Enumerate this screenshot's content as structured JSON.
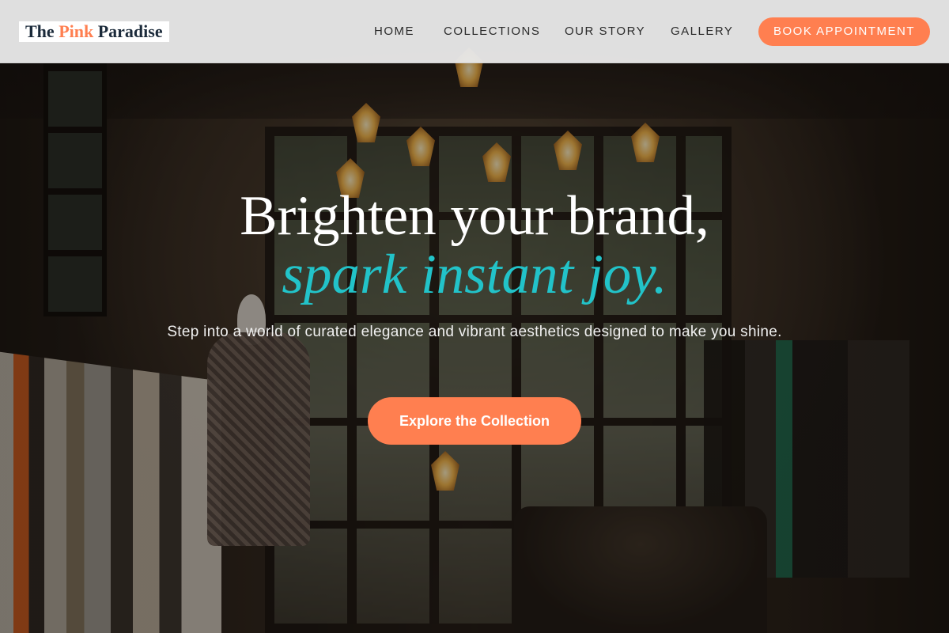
{
  "brand": {
    "logo_part1": "The ",
    "logo_accent": "Pink",
    "logo_part2": " Paradise",
    "accent_color": "#ff7f50",
    "highlight_color": "#22c3c9"
  },
  "nav": {
    "items": [
      {
        "label": "HOME"
      },
      {
        "label": "COLLECTIONS"
      },
      {
        "label": "OUR STORY"
      },
      {
        "label": "GALLERY"
      }
    ],
    "cta_label": "BOOK APPOINTMENT"
  },
  "hero": {
    "title_line1": "Brighten your brand,",
    "title_line2": "spark instant joy.",
    "subtitle": "Step into a world of curated elegance and vibrant aesthetics designed to make you shine.",
    "cta_label": "Explore the Collection"
  }
}
